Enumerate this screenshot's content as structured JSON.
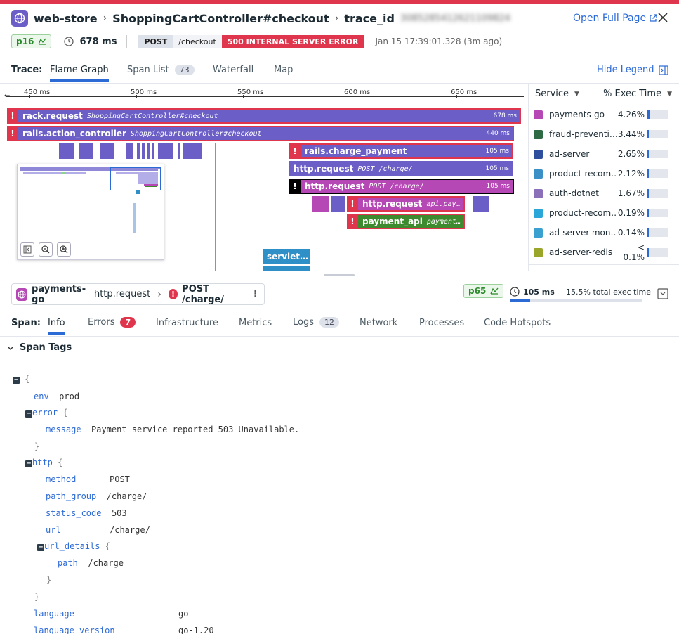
{
  "header": {
    "service": "web-store",
    "resource": "ShoppingCartController#checkout",
    "trace_label": "trace_id",
    "trace_id": "3085285412621109824",
    "open_full_page": "Open Full Page",
    "percentile": "p16",
    "duration": "678 ms",
    "method": "POST",
    "path": "/checkout",
    "status": "500 INTERNAL SERVER ERROR",
    "timestamp": "Jan 15 17:39:01.328 (3m ago)"
  },
  "trace_tabs": {
    "label": "Trace:",
    "items": [
      {
        "label": "Flame Graph"
      },
      {
        "label": "Span List",
        "count": "73"
      },
      {
        "label": "Waterfall"
      },
      {
        "label": "Map"
      }
    ],
    "hide_legend": "Hide Legend"
  },
  "axis": {
    "ticks": [
      "450 ms",
      "500 ms",
      "550 ms",
      "600 ms",
      "650 ms"
    ]
  },
  "flame": {
    "spans": [
      {
        "name": "rack.request",
        "resource": "ShoppingCartController#checkout",
        "duration": "678 ms"
      },
      {
        "name": "rails.action_controller",
        "resource": "ShoppingCartController#checkout",
        "duration": "440 ms"
      },
      {
        "name": "rails.charge_payment",
        "resource": "",
        "duration": "105 ms"
      },
      {
        "name": "http.request",
        "resource": "POST /charge/",
        "duration": "105 ms"
      },
      {
        "name": "http.request",
        "resource": "POST /charge/",
        "duration": "105 ms"
      },
      {
        "name": "http.request",
        "resource": "api.pay…",
        "duration": ""
      },
      {
        "name": "payment_api",
        "resource": "payment…",
        "duration": ""
      },
      {
        "name": "servlet…",
        "resource": "",
        "duration": ""
      }
    ]
  },
  "legend": {
    "col_service": "Service",
    "col_exec": "% Exec Time",
    "rows": [
      {
        "name": "payments-go",
        "pct": "4.26%",
        "color": "#b548b5",
        "fill": 0.0426
      },
      {
        "name": "fraud-preventi…",
        "pct": "3.44%",
        "color": "#2e6b45",
        "fill": 0.0344
      },
      {
        "name": "ad-server",
        "pct": "2.65%",
        "color": "#2d4f9e",
        "fill": 0.0265
      },
      {
        "name": "product-recom…",
        "pct": "2.12%",
        "color": "#3a8fc7",
        "fill": 0.0212
      },
      {
        "name": "auth-dotnet",
        "pct": "1.67%",
        "color": "#8b6fb8",
        "fill": 0.0167
      },
      {
        "name": "product-recom…",
        "pct": "0.19%",
        "color": "#2aa7d8",
        "fill": 0.0019
      },
      {
        "name": "ad-server-mon…",
        "pct": "0.14%",
        "color": "#3aa0d0",
        "fill": 0.0014
      },
      {
        "name": "ad-server-redis",
        "pct": "< 0.1%",
        "color": "#9aa62a",
        "fill": 0.0005
      }
    ]
  },
  "span_header": {
    "service": "payments-go",
    "operation": "http.request",
    "resource": "POST /charge/",
    "percentile": "p65",
    "duration": "105 ms",
    "exec_time": "15.5% total exec time",
    "exec_fraction": 0.155
  },
  "span_tabs": {
    "label": "Span:",
    "items": [
      {
        "label": "Info"
      },
      {
        "label": "Errors",
        "count": "7"
      },
      {
        "label": "Infrastructure"
      },
      {
        "label": "Metrics"
      },
      {
        "label": "Logs",
        "count": "12"
      },
      {
        "label": "Network"
      },
      {
        "label": "Processes"
      },
      {
        "label": "Code Hotspots"
      }
    ]
  },
  "span_tags": {
    "title": "Span Tags",
    "env_key": "env",
    "env_val": "prod",
    "error_key": "error",
    "message_key": "message",
    "message_val": "Payment service reported 503 Unavailable.",
    "http_key": "http",
    "method_key": "method",
    "method_val": "POST",
    "path_group_key": "path_group",
    "path_group_val": "/charge/",
    "status_code_key": "status_code",
    "status_code_val": "503",
    "url_key": "url",
    "url_val": "/charge/",
    "url_details_key": "url_details",
    "path_key": "path",
    "path_val": "/charge",
    "language_key": "language",
    "language_val": "go",
    "language_version_key": "language_version",
    "language_version_val": "go-1.20"
  }
}
